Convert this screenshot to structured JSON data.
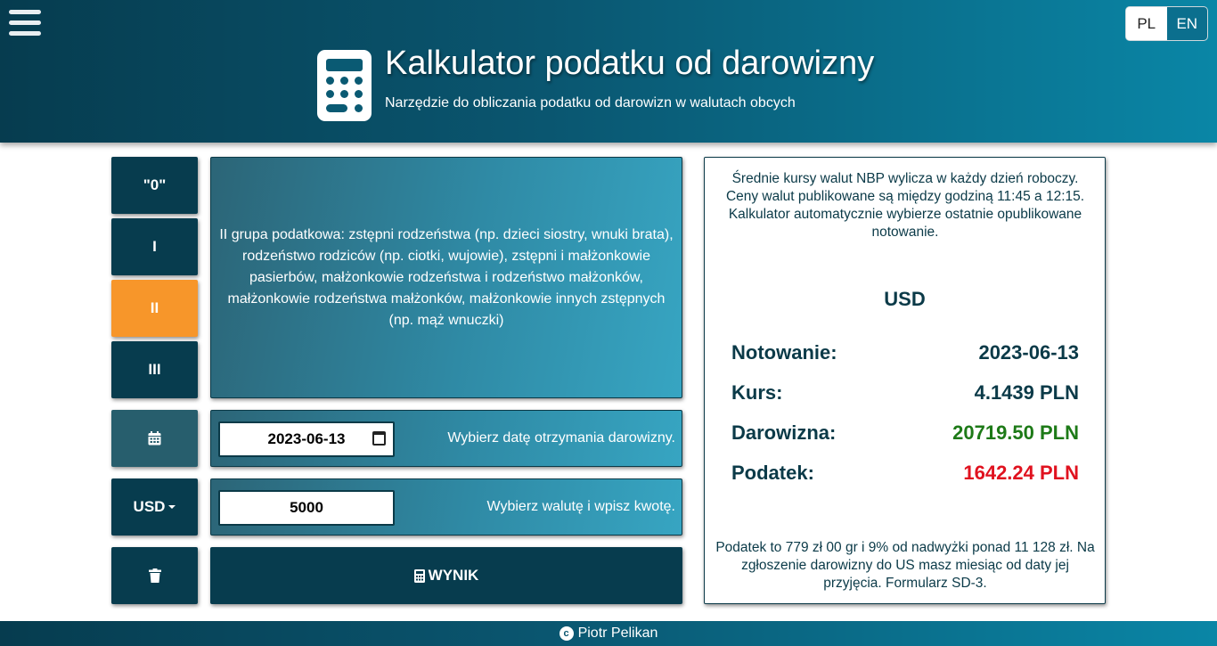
{
  "header": {
    "title": "Kalkulator podatku od darowizny",
    "subtitle": "Narzędzie do obliczania podatku od darowizn w walutach obcych",
    "languages": [
      "PL",
      "EN"
    ],
    "active_language": "EN"
  },
  "tax_groups": [
    "\"0\"",
    "I",
    "II",
    "III"
  ],
  "selected_group": "II",
  "group_description": "II grupa podatkowa: zstępni rodzeństwa (np. dzieci siostry, wnuki brata), rodzeństwo rodziców (np. ciotki, wujowie), zstępni i małżonkowie pasierbów, małżonkowie rodzeństwa i rodzeństwo małżonków, małżonkowie rodzeństwa małżonków, małżonkowie innych zstępnych (np. mąż wnuczki)",
  "date_row": {
    "icon": "calendar-icon",
    "value": "2023-06-13",
    "hint": "Wybierz datę otrzymania darowizny."
  },
  "amount_row": {
    "currency_label": "USD",
    "value": "5000",
    "hint": "Wybierz walutę i wpisz kwotę."
  },
  "delete_icon": "trash-icon",
  "calculate_button": {
    "icon": "calculator-icon",
    "label": "WYNIK"
  },
  "result": {
    "note_top": "Średnie kursy walut NBP wylicza w każdy dzień roboczy. Ceny walut publikowane są między godziną 11:45 a 12:15. Kalkulator automatycznie wybierze ostatnie opublikowane notowanie.",
    "currency": "USD",
    "rows": [
      {
        "label": "Notowanie:",
        "value": "2023-06-13"
      },
      {
        "label": "Kurs:",
        "value": "4.1439 PLN"
      },
      {
        "label": "Darowizna:",
        "value": "20719.50 PLN"
      },
      {
        "label": "Podatek:",
        "value": "1642.24 PLN"
      }
    ],
    "note_bottom": "Podatek to 779 zł 00 gr i 9% od nadwyżki ponad 11 128 zł. Na zgłoszenie darowizny do US masz miesiąc od daty jej przyjęcia. Formularz SD-3."
  },
  "colors": {
    "accent": "#f7962a",
    "dark": "#073c4e",
    "positive": "#1d7a17",
    "negative": "#e0121f"
  },
  "footer": {
    "author": "Piotr Pelikan"
  }
}
